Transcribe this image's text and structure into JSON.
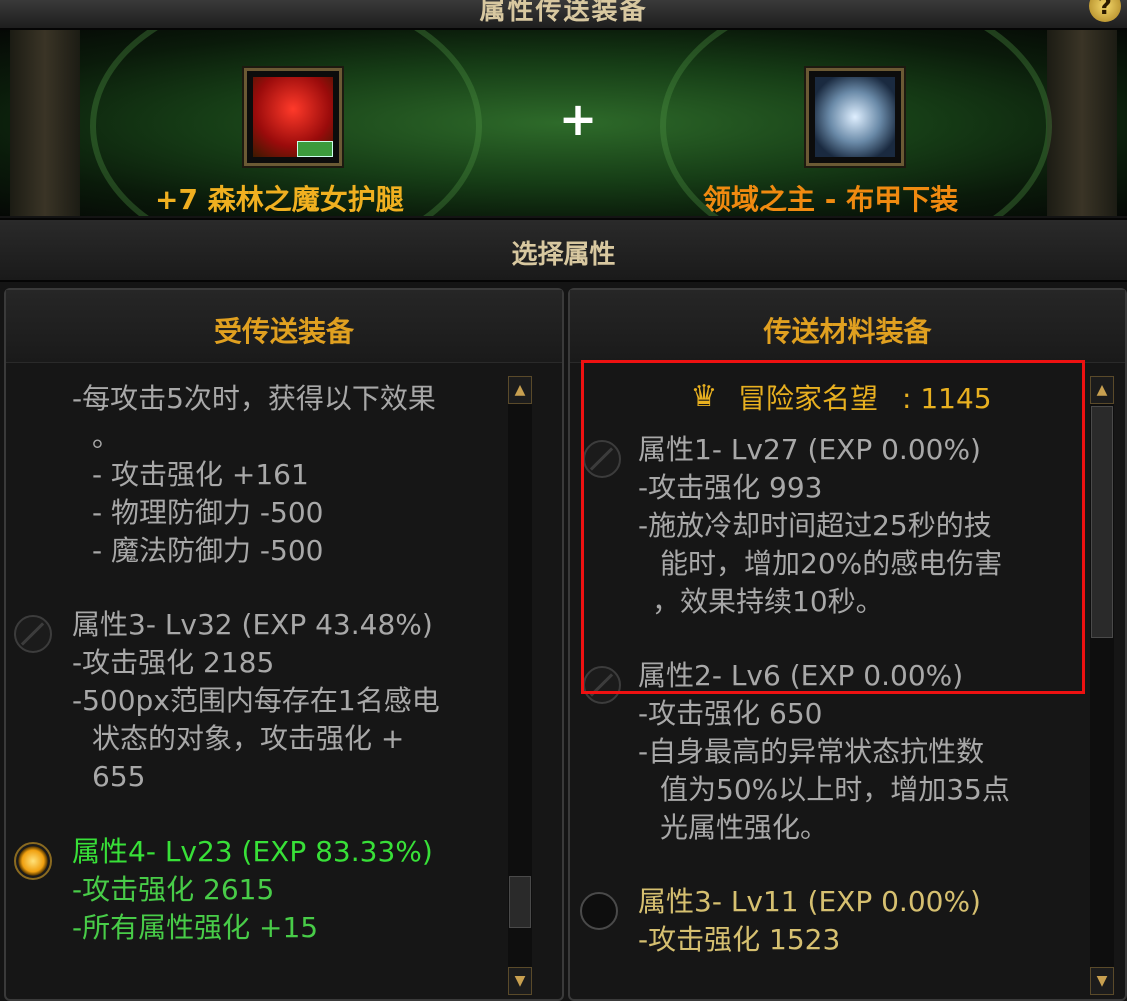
{
  "header": {
    "title": "属性传送装备",
    "help_label": "?"
  },
  "transfer": {
    "target_item_name": "+7 森林之魔女护腿",
    "material_item_name": "领域之主 - 布甲下装",
    "plus_symbol": "+",
    "target_icon": "red-leg-armor-icon",
    "material_icon": "silver-cloth-leg-icon"
  },
  "select_attributes": {
    "title": "选择属性"
  },
  "left_panel": {
    "title": "受传送装备",
    "lines": {
      "l1": "-每攻击5次时，获得以下效果",
      "l2": "。",
      "l3": "- 攻击强化 +161",
      "l4": "- 物理防御力 -500",
      "l5": "- 魔法防御力 -500"
    },
    "attr3": {
      "header": "属性3- Lv32 (EXP 43.48%)",
      "line1": "-攻击强化 2185",
      "line2": "-500px范围内每存在1名感电",
      "line3": "状态的对象，攻击强化 +",
      "line4": "655"
    },
    "attr4": {
      "header": "属性4- Lv23 (EXP 83.33%)",
      "line1": "-攻击强化 2615",
      "line2": "-所有属性强化 +15"
    }
  },
  "right_panel": {
    "title": "传送材料装备",
    "reputation_label": "冒险家名望",
    "reputation_value": ": 1145",
    "attr1": {
      "header": "属性1- Lv27 (EXP 0.00%)",
      "line1": "-攻击强化 993",
      "line2": "-施放冷却时间超过25秒的技",
      "line3": "能时，增加20%的感电伤害",
      "line4": "，效果持续10秒。"
    },
    "attr2": {
      "header": "属性2- Lv6 (EXP 0.00%)",
      "line1": "-攻击强化 650",
      "line2": "-自身最高的异常状态抗性数",
      "line3": "值为50%以上时，增加35点",
      "line4": "光属性强化。"
    },
    "attr3": {
      "header": "属性3- Lv11 (EXP 0.00%)",
      "line1": "-攻击强化 1523"
    }
  },
  "colors": {
    "selected_text": "#38e038",
    "gold_text": "#e8b020",
    "highlight_box": "#ee1111"
  }
}
